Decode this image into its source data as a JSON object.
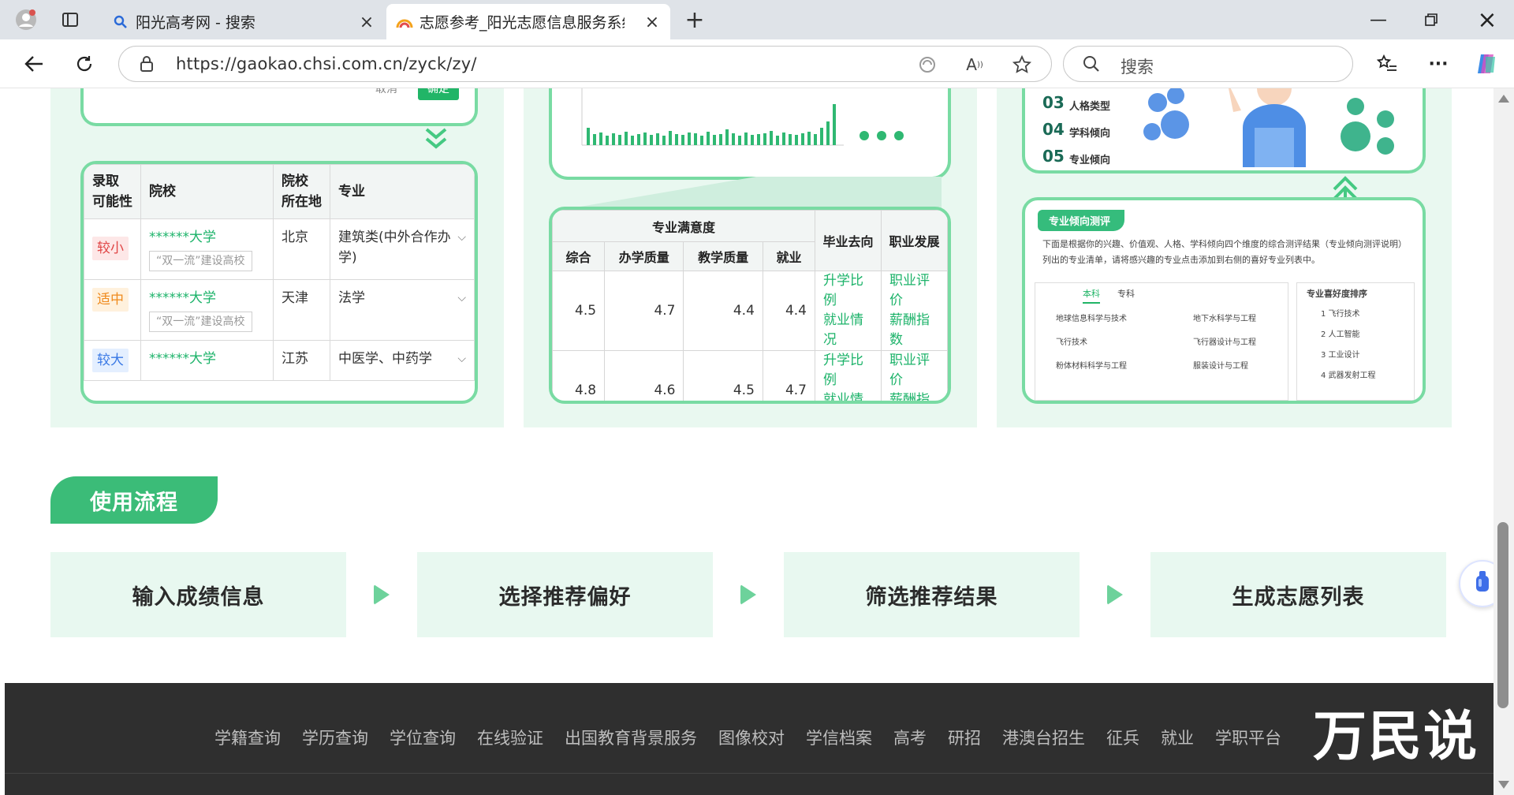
{
  "browser": {
    "tabs": [
      {
        "title": "阳光高考网 - 搜索",
        "active": false
      },
      {
        "title": "志愿参考_阳光志愿信息服务系统",
        "active": true
      }
    ],
    "new_tab": "+",
    "url": "https://gaokao.chsi.com.cn/zyck/zy/",
    "search_placeholder": "搜索",
    "close_glyph": "×"
  },
  "panel1": {
    "cancel_label": "取消",
    "ok_label": "确定",
    "headers": [
      "录取可能性",
      "院校",
      "院校所在地",
      "专业"
    ],
    "header_lines": {
      "chance": [
        "录取",
        "可能性"
      ],
      "school": "院校",
      "location": [
        "院校",
        "所在地"
      ],
      "major": "专业"
    },
    "rows": [
      {
        "chance": "较小",
        "school": "******大学",
        "tag": "“双一流”建设高校",
        "location": "北京",
        "major": "建筑类(中外合作办学)"
      },
      {
        "chance": "适中",
        "school": "******大学",
        "tag": "“双一流”建设高校",
        "location": "天津",
        "major": "法学"
      },
      {
        "chance": "较大",
        "school": "******大学",
        "tag": "",
        "location": "江苏",
        "major": "中医学、中药学"
      }
    ]
  },
  "panel2": {
    "group_header": "专业满意度",
    "sub_headers": [
      "综合",
      "办学质量",
      "教学质量",
      "就业"
    ],
    "col_grad": "毕业去向",
    "col_career": "职业发展",
    "rows": [
      {
        "scores": [
          "4.5",
          "4.7",
          "4.4",
          "4.4"
        ],
        "grad": [
          "升学比例",
          "就业情况"
        ],
        "career": [
          "职业评价",
          "薪酬指数"
        ]
      },
      {
        "scores": [
          "4.8",
          "4.6",
          "4.5",
          "4.7"
        ],
        "grad": [
          "升学比例",
          "就业情况"
        ],
        "career": [
          "职业评价",
          "薪酬指数"
        ]
      }
    ]
  },
  "panel3": {
    "items": [
      {
        "num": "03",
        "label": "人格类型"
      },
      {
        "num": "04",
        "label": "学科倾向"
      },
      {
        "num": "05",
        "label": "专业倾向"
      }
    ],
    "eval_title": "专业倾向测评",
    "eval_desc_1": "下面是根据你的兴趣、价值观、人格、学科倾向四个维度的综合测评结果（专业倾向测评说明）",
    "eval_desc_2": "列出的专业清单，请将感兴趣的专业点击添加到右侧的喜好专业列表中。",
    "tab_ben": "本科",
    "tab_zhuan": "专科",
    "majors": [
      "地球信息科学与技术",
      "地下水科学与工程",
      "飞行技术",
      "飞行器设计与工程",
      "粉体材料科学与工程",
      "服装设计与工程"
    ],
    "pref_title": "专业喜好度排序",
    "pref_list": [
      "1 飞行技术",
      "2 人工智能",
      "3 工业设计",
      "4 武器发射工程"
    ]
  },
  "flow": {
    "section_title": "使用流程",
    "steps": [
      "输入成绩信息",
      "选择推荐偏好",
      "筛选推荐结果",
      "生成志愿列表"
    ]
  },
  "footer": {
    "links": [
      "学籍查询",
      "学历查询",
      "学位查询",
      "在线验证",
      "出国教育背景服务",
      "图像校对",
      "学信档案",
      "高考",
      "研招",
      "港澳台招生",
      "征兵",
      "就业",
      "学职平台"
    ]
  },
  "watermark": "万民说",
  "colors": {
    "accent": "#21b567",
    "panel_bg": "#e9f8f0",
    "footer_bg": "#2f2f2f"
  }
}
